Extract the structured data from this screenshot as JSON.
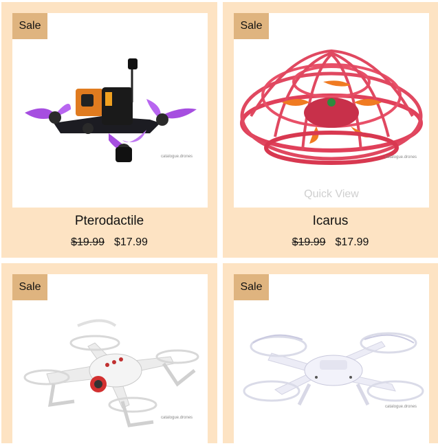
{
  "products": [
    {
      "name": "Pterodactile",
      "sale_badge": "Sale",
      "old_price": "$19.99",
      "price": "$17.99",
      "image_icon": "racing-drone-image",
      "watermark": "catalogue.drones"
    },
    {
      "name": "Icarus",
      "sale_badge": "Sale",
      "old_price": "$19.99",
      "price": "$17.99",
      "image_icon": "ufo-drone-image",
      "quick_view": "Quick View",
      "watermark": "catalogue.drones"
    },
    {
      "sale_badge": "Sale",
      "image_icon": "white-quadcopter-image",
      "watermark": "catalogue.drones"
    },
    {
      "sale_badge": "Sale",
      "image_icon": "white-camera-drone-image",
      "watermark": "catalogue.drones"
    }
  ],
  "colors": {
    "card_bg": "#fde3c3",
    "badge_bg": "#dfb47f",
    "page_bg": "#ffffff"
  }
}
